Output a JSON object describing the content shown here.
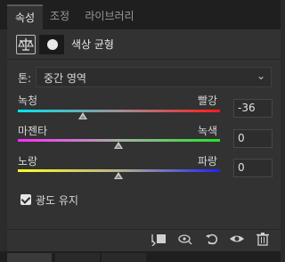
{
  "tabs": [
    {
      "label": "속성",
      "active": true
    },
    {
      "label": "조정",
      "active": false
    },
    {
      "label": "라이브러리",
      "active": false
    }
  ],
  "header": {
    "title": "색상 균형",
    "icon": "balance-scale-icon",
    "mask_icon": "layer-mask-icon"
  },
  "tone": {
    "label": "톤:",
    "value": "중간 영역"
  },
  "sliders": [
    {
      "left": "녹청",
      "right": "빨강",
      "value": "-36",
      "level": -36
    },
    {
      "left": "마젠타",
      "right": "녹색",
      "value": "0",
      "level": 0
    },
    {
      "left": "노랑",
      "right": "파랑",
      "value": "0",
      "level": 0
    }
  ],
  "preserve_luminosity": {
    "label": "광도 유지",
    "checked": true
  },
  "footer": {
    "icons": [
      "clip-to-layer-icon",
      "view-previous-state-icon",
      "reset-icon",
      "visibility-eye-icon",
      "trash-icon"
    ]
  }
}
